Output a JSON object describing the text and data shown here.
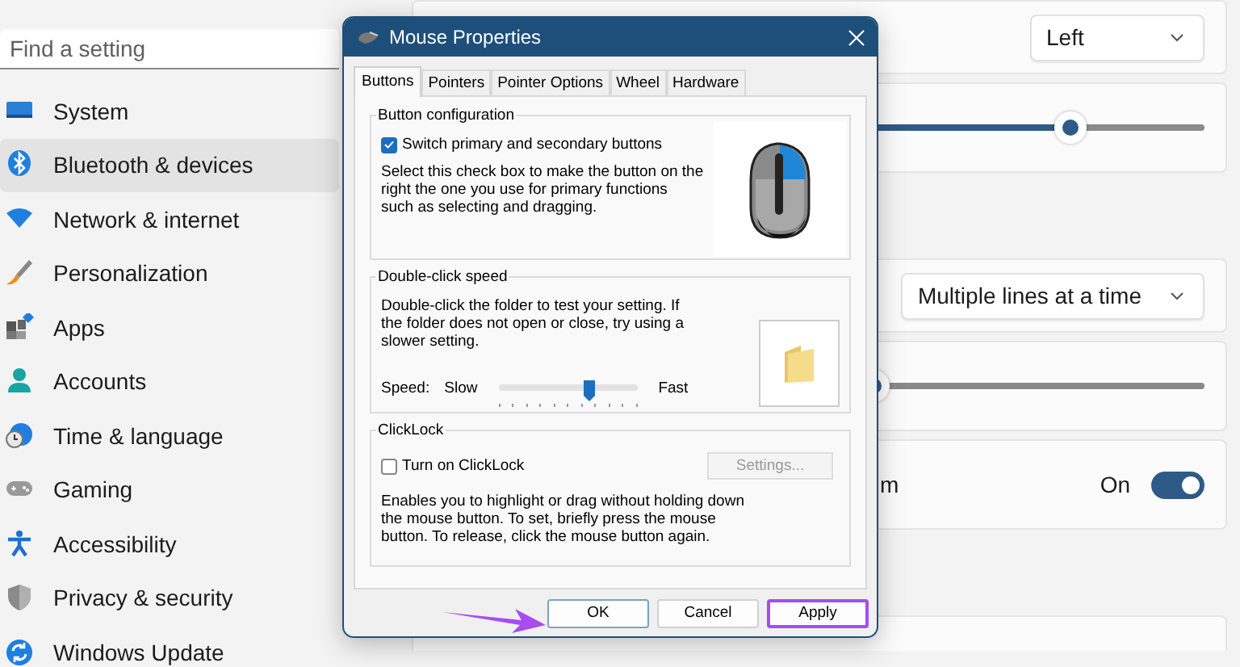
{
  "search": {
    "placeholder": "Find a setting"
  },
  "sidebar": {
    "items": [
      {
        "label": "System",
        "selected": false
      },
      {
        "label": "Bluetooth & devices",
        "selected": true
      },
      {
        "label": "Network & internet",
        "selected": false
      },
      {
        "label": "Personalization",
        "selected": false
      },
      {
        "label": "Apps",
        "selected": false
      },
      {
        "label": "Accounts",
        "selected": false
      },
      {
        "label": "Time & language",
        "selected": false
      },
      {
        "label": "Gaming",
        "selected": false
      },
      {
        "label": "Accessibility",
        "selected": false
      },
      {
        "label": "Privacy & security",
        "selected": false
      },
      {
        "label": "Windows Update",
        "selected": false
      }
    ]
  },
  "sections": [
    {
      "cards": [
        {
          "kind": "dropdown",
          "value": "Left"
        },
        {
          "kind": "slider",
          "level": 0.74
        }
      ]
    },
    {
      "cards": [
        {
          "kind": "dropdown",
          "value": "Multiple lines at a time"
        },
        {
          "kind": "slider",
          "level": 0.36
        },
        {
          "kind": "toggle",
          "label": "m",
          "state_text": "On",
          "on": true
        }
      ]
    },
    {
      "cards": [
        {
          "kind": "plain"
        }
      ]
    }
  ],
  "dialog": {
    "title": "Mouse Properties",
    "tabs": [
      {
        "label": "Buttons",
        "selected": true
      },
      {
        "label": "Pointers",
        "selected": false
      },
      {
        "label": "Pointer Options",
        "selected": false
      },
      {
        "label": "Wheel",
        "selected": false
      },
      {
        "label": "Hardware",
        "selected": false
      }
    ],
    "button_configuration": {
      "title": "Button configuration",
      "checkbox": {
        "label": "Switch primary and secondary buttons",
        "checked": true
      },
      "description": "Select this check box to make the button on the right the one you use for primary functions such as selecting and dragging."
    },
    "double_click_speed": {
      "title": "Double-click speed",
      "description": "Double-click the folder to test your setting. If the folder does not open or close, try using a slower setting.",
      "speed_label": "Speed:",
      "slow_label": "Slow",
      "fast_label": "Fast",
      "level": 0.66
    },
    "clicklock": {
      "title": "ClickLock",
      "checkbox": {
        "label": "Turn on ClickLock",
        "checked": false
      },
      "settings_button": {
        "label": "Settings...",
        "disabled": true
      },
      "description": "Enables you to highlight or drag without holding down the mouse button. To set, briefly press the mouse button. To release, click the mouse button again."
    },
    "buttons": [
      {
        "label": "OK",
        "default": true,
        "highlighted": false
      },
      {
        "label": "Cancel",
        "default": false,
        "highlighted": false
      },
      {
        "label": "Apply",
        "default": false,
        "highlighted": true
      }
    ]
  }
}
